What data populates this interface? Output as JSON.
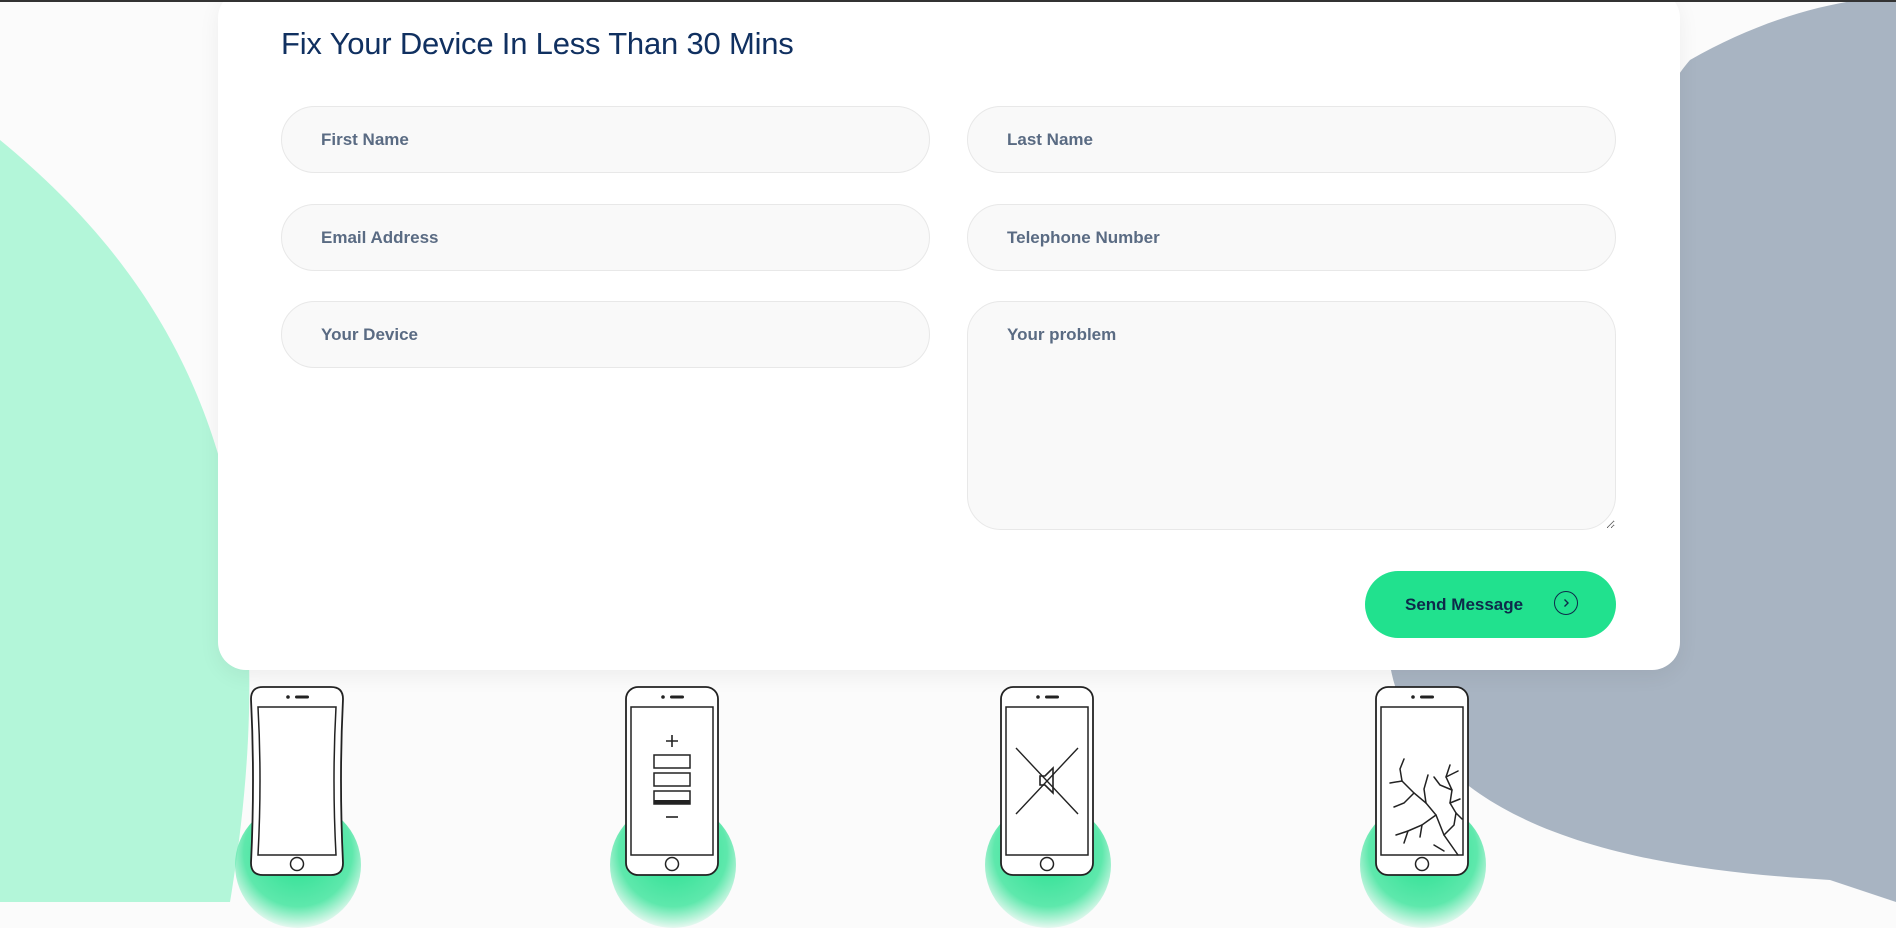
{
  "form": {
    "title": "Fix Your Device In Less Than 30 Mins",
    "fields": {
      "first_name": "First Name",
      "last_name": "Last Name",
      "email": "Email Address",
      "telephone": "Telephone Number",
      "device": "Your Device",
      "problem": "Your problem"
    },
    "submit_label": "Send Message"
  },
  "services": [
    {
      "icon": "bent-phone-icon"
    },
    {
      "icon": "phone-battery-icon"
    },
    {
      "icon": "phone-speaker-muted-icon"
    },
    {
      "icon": "cracked-screen-phone-icon"
    }
  ],
  "colors": {
    "accent": "#21e18e",
    "title": "#103060",
    "mint_blob": "#b3f6d9",
    "slate_blob": "#a8b4c2",
    "page_bg": "#fbfbfb"
  }
}
